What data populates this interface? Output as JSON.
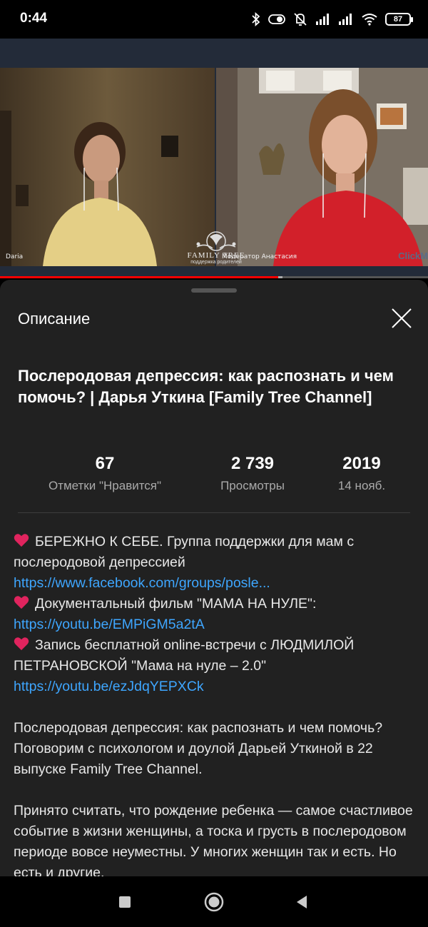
{
  "status_bar": {
    "time": "0:44",
    "battery": "87",
    "icons": [
      "bluetooth-icon",
      "toggle-icon",
      "mute-icon",
      "signal-icon",
      "signal-icon",
      "wifi-icon",
      "battery-icon"
    ]
  },
  "player": {
    "participants": [
      {
        "name": "Daria"
      },
      {
        "name": "Модератор Анастасия"
      }
    ],
    "logo_title": "FAMILY TREE",
    "logo_subtitle": "поддержка родителей",
    "watermark": "ClickM",
    "progress_fraction": 0.65,
    "buffer_fraction": 0.66
  },
  "panel": {
    "title": "Описание",
    "video_title": "Послеродовая депрессия: как распознать и чем помочь? | Дарья Уткина  [Family Tree Channel]",
    "stats": {
      "likes_value": "67",
      "likes_label": "Отметки \"Нравится\"",
      "views_value": "2 739",
      "views_label": "Просмотры",
      "year_value": "2019",
      "date_label": "14 нояб."
    },
    "description": {
      "item1_text": "БЕРЕЖНО К СЕБЕ. Группа поддержки для мам с послеродовой депрессией ",
      "item1_link": "https://www.facebook.com/groups/posle...",
      "item2_text": "Документальный фильм \"МАМА НА НУЛЕ\": ",
      "item2_link": "https://youtu.be/EMPiGM5a2tA",
      "item3_text": "Запись бесплатной online-встречи с ЛЮДМИЛОЙ ПЕТРАНОВСКОЙ \"Мама на нуле – 2.0\" ",
      "item3_link": "https://youtu.be/ezJdqYEPXCk",
      "para1": "Послеродовая депрессия: как распознать и чем помочь? Поговорим с психологом и доулой Дарьей Уткиной в 22 выпуске Family Tree Channel.",
      "para2": "Принято считать, что рождение ребенка — самое счастливое событие в жизни женщины, а тоска и грусть в послеродовом периоде вовсе неуместны. У многих женщин так и есть. Но есть и другие."
    }
  },
  "colors": {
    "panel_bg": "#212121",
    "link": "#3ea6ff",
    "progress": "#ff0000",
    "heart": "#e0245e"
  }
}
